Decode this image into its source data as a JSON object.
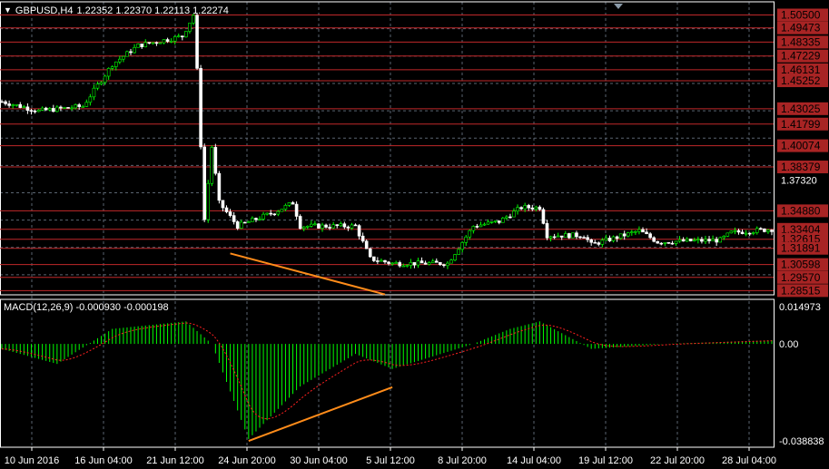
{
  "header": {
    "symbol": "GBPUSD,H4",
    "ohlc": "1.22352 1.22370 1.22113 1.22274"
  },
  "macd_header": "MACD(12,26,9) -0.000930 -0.000198",
  "colors": {
    "bull": "#00ff00",
    "bear": "#ffffff",
    "level": "#c0282a",
    "trend": "#ff8c1a",
    "grid": "#5a6470",
    "signal": "#ff2020"
  },
  "price_axis": {
    "max": 1.5155,
    "min": 1.2818,
    "white_labels": [
      "1.37320"
    ]
  },
  "levels": [
    "1.50500",
    "1.49473",
    "1.48335",
    "1.47229",
    "1.46131",
    "1.45252",
    "1.43025",
    "1.41799",
    "1.40074",
    "1.38379",
    "1.34880",
    "1.33404",
    "1.32615",
    "1.31891",
    "1.30598",
    "1.29570",
    "1.28515"
  ],
  "macd_axis": {
    "labels": [
      "0.014973",
      "0.00",
      "-0.038838"
    ],
    "max": 0.0178,
    "min": -0.0413
  },
  "time_labels": [
    "10 Jun 2016",
    "16 Jun 04:00",
    "21 Jun 12:00",
    "24 Jun 20:00",
    "30 Jun 04:00",
    "5 Jul 12:00",
    "8 Jul 20:00",
    "14 Jul 04:00",
    "19 Jul 12:00",
    "22 Jul 20:00",
    "28 Jul 04:00"
  ],
  "chart_data": {
    "type": "candlestick",
    "candles": 210,
    "price_waypoints": [
      [
        0,
        1.4359
      ],
      [
        10,
        1.4285
      ],
      [
        22,
        1.4322
      ],
      [
        30,
        1.4657
      ],
      [
        37,
        1.4806
      ],
      [
        49,
        1.488
      ],
      [
        52,
        1.505
      ],
      [
        53,
        1.4608
      ],
      [
        55,
        1.3418
      ],
      [
        57,
        1.3998
      ],
      [
        59,
        1.3552
      ],
      [
        64,
        1.3366
      ],
      [
        74,
        1.3478
      ],
      [
        79,
        1.3552
      ],
      [
        81,
        1.3366
      ],
      [
        96,
        1.3366
      ],
      [
        100,
        1.3106
      ],
      [
        106,
        1.3069
      ],
      [
        121,
        1.3069
      ],
      [
        128,
        1.3366
      ],
      [
        135,
        1.3403
      ],
      [
        141,
        1.3515
      ],
      [
        146,
        1.3515
      ],
      [
        148,
        1.3292
      ],
      [
        158,
        1.3292
      ],
      [
        160,
        1.3218
      ],
      [
        173,
        1.3329
      ],
      [
        178,
        1.324
      ],
      [
        195,
        1.3255
      ],
      [
        198,
        1.3314
      ],
      [
        210,
        1.3344
      ]
    ],
    "macd_waypoints": [
      [
        0,
        -0.002
      ],
      [
        15,
        -0.008
      ],
      [
        30,
        0.006
      ],
      [
        50,
        0.009
      ],
      [
        57,
        0.0
      ],
      [
        67,
        -0.038
      ],
      [
        81,
        -0.017
      ],
      [
        96,
        -0.004
      ],
      [
        106,
        -0.01
      ],
      [
        128,
        0.0
      ],
      [
        138,
        0.006
      ],
      [
        146,
        0.009
      ],
      [
        160,
        -0.002
      ],
      [
        180,
        0.0
      ],
      [
        210,
        0.0015
      ]
    ],
    "trendlines": [
      {
        "pane": "price",
        "from": [
          62,
          1.3148
        ],
        "to": [
          104,
          1.2821
        ]
      },
      {
        "pane": "macd",
        "from": [
          67,
          -0.0388
        ],
        "to": [
          106,
          -0.0173
        ]
      }
    ]
  }
}
